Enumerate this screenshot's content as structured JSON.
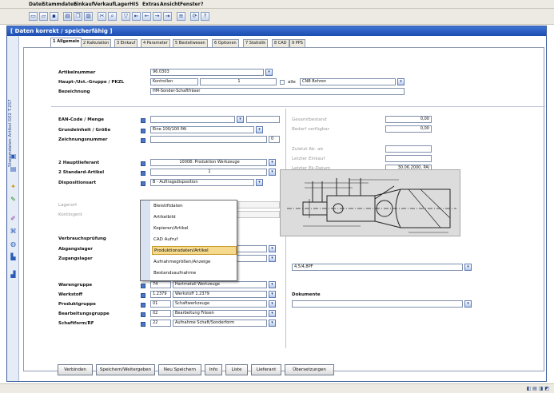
{
  "menu": [
    "Datei",
    "Stammdaten",
    "Einkauf",
    "Verkauf",
    "Lager",
    "HIS",
    "Extras",
    "Ansicht",
    "Fenster",
    "?"
  ],
  "toolbar_icons": [
    "new-icon",
    "open-icon",
    "save-icon",
    "print-icon",
    "copy-icon",
    "paste-icon",
    "cut-icon",
    "find-icon",
    "filter-icon",
    "first-icon",
    "prev-icon",
    "next-icon",
    "last-icon",
    "list-icon",
    "refresh-icon",
    "help-icon"
  ],
  "window": {
    "title": "[ Daten korrekt / speicherfähig ]"
  },
  "sidebar": {
    "title": "Stammdaten  Artikel  G02  T.2S7"
  },
  "tabs": [
    "1 Allgemein",
    "2 Kalkulation",
    "3 Einkauf",
    "4 Parameter",
    "5 Bestellwesen",
    "6 Optionen",
    "7 Statistik",
    "8 CAD",
    "9 PPS"
  ],
  "form": {
    "artikelnummer_label": "Artikelnummer",
    "artikelnummer_value": "96.0303",
    "gruppe_label": "Haupt-/Ust.-Gruppe / PKZL",
    "gruppe_value": "Kontrollen",
    "gruppe_value2": "1",
    "gruppe_extra": "alle",
    "gruppe_extra2": "CNB Bohren",
    "bezeichnung_label": "Bezeichnung",
    "bezeichnung_value": "HM-Sonder-Schaftfräser",
    "ean_label": "EAN-Code / Menge",
    "ean_value": "",
    "groesse_label": "Grundeinheit / Größe",
    "groesse_value": "Eine 100/100 PAl",
    "zeichnung_label": "Zeichnungsnummer",
    "zeichnung_value": "",
    "zeichnung_small": "0",
    "hauptlieferant_label": "2 Hauptlieferant",
    "hauptlieferant_value": "10008: Produktion Werkzeuge",
    "standard_label": "2 Standard-Artikel",
    "standard_value": "1",
    "disposition_label": "Dispositionsart",
    "disposition_value": "B - Auftragsdisposition",
    "lagerort_label": "Lagerort",
    "kontingent_label": "Kontingent",
    "verbrauch_label": "Verbrauchsprüfung",
    "abgang_label": "Abgangslager",
    "zugang_label": "Zugangslager",
    "warengruppe_label": "Warengruppe",
    "warengruppe_code": "74",
    "warengruppe_value": "Hartmetall Werkzeuge",
    "werkstoff_label": "Werkstoff",
    "werkstoff_code": "1.2379",
    "werkstoff_value": "Werkstoff 1.2379",
    "produktgruppe_label": "Produktgruppe",
    "produktgruppe_code": "01",
    "produktgruppe_value": "Schaftwerkzeuge",
    "bearbeitung_label": "Bearbeitungsgruppe",
    "bearbeitung_code": "02",
    "bearbeitung_value": "Bearbeitung Fräsen",
    "schaftform_label": "Schaftform/RF",
    "schaftform_code": "22",
    "schaftform_value": "Aufnahme Schaft/Sonderform"
  },
  "right": {
    "gesamt_label": "Gesamtbestand",
    "gesamt_value": "0,00",
    "bedarf_label": "Bedarf verfügbar",
    "bedarf_value": "0,00",
    "letzte_ab_label": "Zuletzt Ab- ab",
    "letzte_eink_label": "Letzter Einkauf",
    "letzte_datum_label": "Letzter Ek-Datum",
    "letzte_datum_value": "30.06.2000, PAl",
    "cad_value": "4,5/4,8PF",
    "dokumente_label": "Dokumente",
    "dokumente_value": ""
  },
  "popup": [
    "Bleistiftdaten",
    "Artikelbild",
    "Kopieren/Artikel",
    "CAD Aufruf",
    "Produktionsdaten/Artikel",
    "Aufnahmegrößen/Anzeige",
    "Bestandsaufnahme"
  ],
  "popup_selected": 4,
  "buttons": [
    "Verbinden",
    "Speichern/Weitergeben",
    "Neu Speichern",
    "Info",
    "Liste",
    "Lieferant",
    "Übersetzungen"
  ],
  "status": {
    "tray": "◧ ▤ ◨ ◩"
  }
}
